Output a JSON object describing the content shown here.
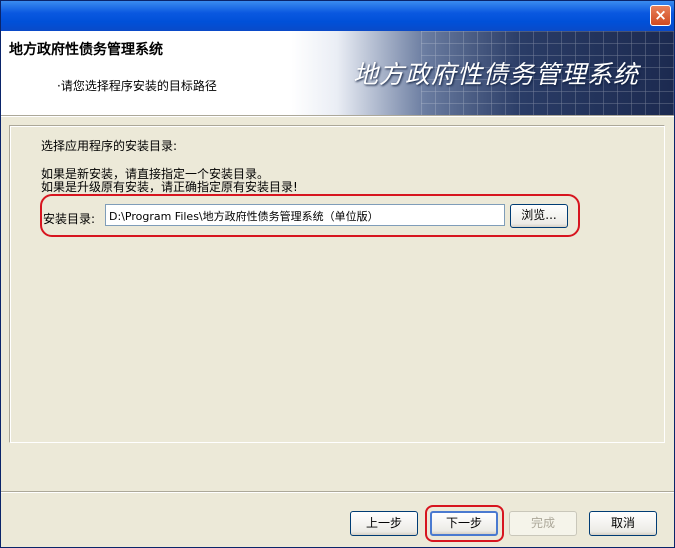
{
  "window": {
    "close_symbol": "×",
    "accent_color": "#0054e3",
    "highlight_color": "#d7151f"
  },
  "header": {
    "title": "地方政府性债务管理系统",
    "subtitle": "·请您选择程序安装的目标路径",
    "banner_text": "地方政府性债务管理系统"
  },
  "content": {
    "line1": "选择应用程序的安装目录:",
    "line2": "如果是新安装，请直接指定一个安装目录。",
    "line3": "如果是升级原有安装，请正确指定原有安装目录!",
    "path_label": "安装目录:",
    "path_value": "D:\\Program Files\\地方政府性债务管理系统（单位版）",
    "browse_label": "浏览..."
  },
  "footer": {
    "prev_label": "上一步",
    "next_label": "下一步",
    "finish_label": "完成",
    "cancel_label": "取消"
  }
}
